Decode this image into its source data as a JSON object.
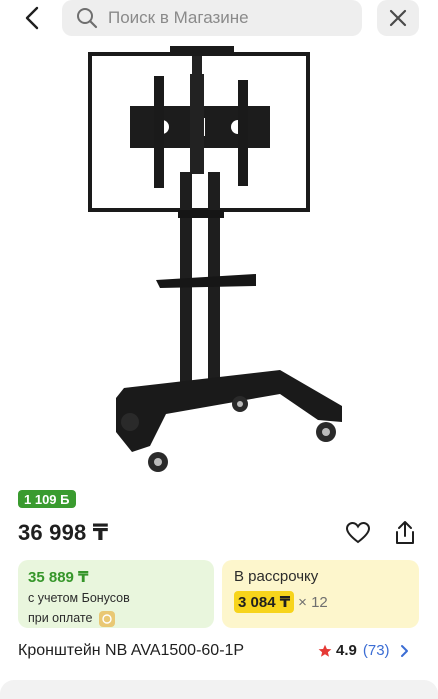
{
  "search": {
    "placeholder": "Поиск в Магазине"
  },
  "product": {
    "bonus_badge": "1 109 Б",
    "price": "36 998 ₸",
    "title": "Кронштейн NB AVA1500-60-1P",
    "rating": "4.9",
    "reviews": "(73)"
  },
  "bonus_card": {
    "amount": "35 889 ₸",
    "line1": "с учетом Бонусов",
    "line2": "при оплате"
  },
  "installment_card": {
    "title": "В рассрочку",
    "monthly": "3 084 ₸",
    "months": "× 12"
  },
  "icons": {
    "back": "chevron-left-icon",
    "search": "search-icon",
    "close": "close-icon",
    "favorite": "heart-icon",
    "share": "share-icon",
    "star": "star-icon",
    "coin": "coin-icon",
    "rating_chevron": "chevron-right-icon"
  },
  "colors": {
    "bonus_green": "#3a9b2f",
    "install_yellow": "#f7d41b",
    "link_blue": "#3b6dd4",
    "star_red": "#e53935"
  }
}
